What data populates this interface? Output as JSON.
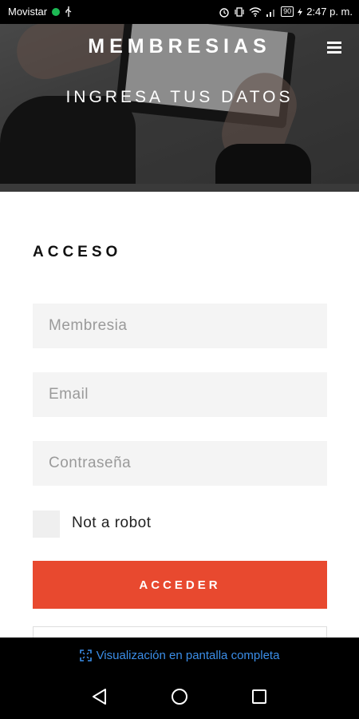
{
  "status_bar": {
    "carrier": "Movistar",
    "battery": "90",
    "time": "2:47 p. m."
  },
  "header": {
    "brand": "MEMBRESIAS",
    "subtitle": "INGRESA TUS DATOS",
    "menu_icon": "hamburger-icon"
  },
  "form": {
    "title": "ACCESO",
    "membership_placeholder": "Membresia",
    "email_placeholder": "Email",
    "password_placeholder": "Contraseña",
    "robot_label": "Not a robot",
    "submit_label": "ACCEDER"
  },
  "fullscreen_banner": {
    "label": "Visualización en pantalla completa",
    "icon": "fullscreen-icon",
    "color": "#3b8ee8"
  },
  "nav": {
    "back_icon": "back-icon",
    "home_icon": "home-icon",
    "recents_icon": "recents-icon"
  },
  "colors": {
    "accent": "#e8492f",
    "field_bg": "#f4f4f4"
  }
}
